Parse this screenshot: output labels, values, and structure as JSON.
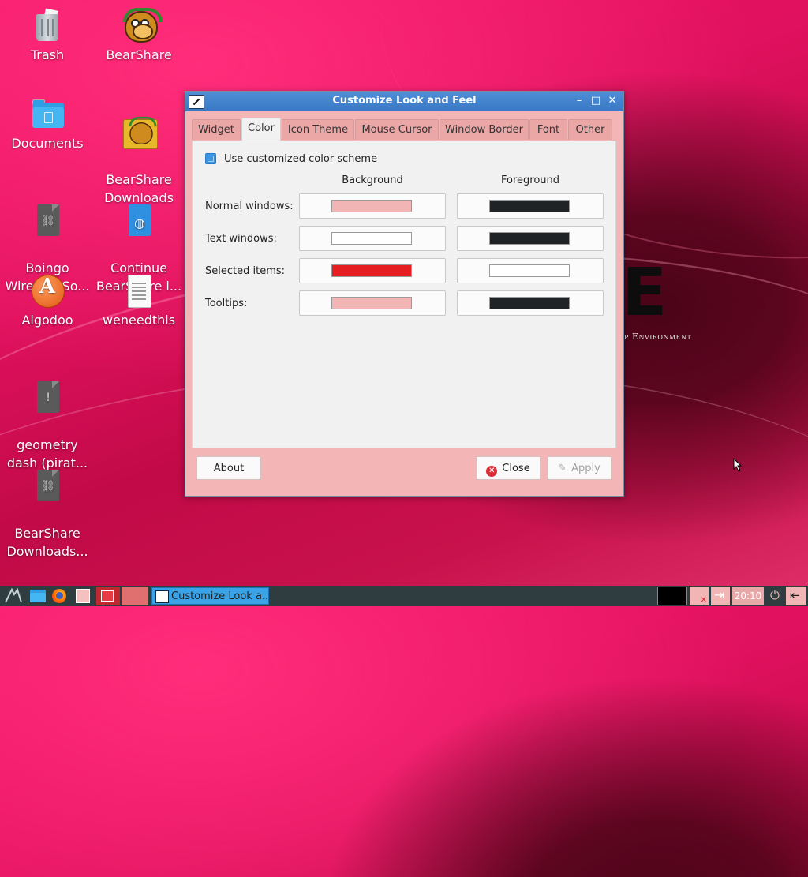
{
  "desktop": {
    "icons": [
      {
        "label": "Trash",
        "icon": "trash-icon"
      },
      {
        "label": "BearShare",
        "icon": "bearshare-icon"
      },
      {
        "label": "Documents",
        "icon": "folder-icon"
      },
      {
        "label": "BearShare\nDownloads",
        "icon": "bearshare-folder-icon"
      },
      {
        "label": "Boingo\nWireless So...",
        "icon": "archive-file-icon"
      },
      {
        "label": "Continue\nBearShare i...",
        "icon": "web-file-icon"
      },
      {
        "label": "Algodoo",
        "icon": "algodoo-icon"
      },
      {
        "label": "weneedthis",
        "icon": "text-file-icon"
      },
      {
        "label": "geometry\ndash (pirat...",
        "icon": "warning-file-icon"
      },
      {
        "label": "BearShare\nDownloads...",
        "icon": "archive-file-icon"
      }
    ],
    "wallpaper_text": {
      "letter": "E",
      "subtitle": "op Environment"
    }
  },
  "dialog": {
    "title": "Customize Look and Feel",
    "tabs": [
      "Widget",
      "Color",
      "Icon Theme",
      "Mouse Cursor",
      "Window Border",
      "Font",
      "Other"
    ],
    "active_tab": "Color",
    "checkbox_label": "Use customized color scheme",
    "columns": {
      "background": "Background",
      "foreground": "Foreground"
    },
    "rows": [
      {
        "label": "Normal windows:",
        "bg": "#f2b5b5",
        "fg": "#1f2326"
      },
      {
        "label": "Text windows:",
        "bg": "#ffffff",
        "fg": "#1f2326"
      },
      {
        "label": "Selected items:",
        "bg": "#e51e22",
        "fg": "#ffffff"
      },
      {
        "label": "Tooltips:",
        "bg": "#f2b5b5",
        "fg": "#1f2326"
      }
    ],
    "buttons": {
      "about": "About",
      "close": "Close",
      "apply": "Apply"
    }
  },
  "taskbar": {
    "task_label": "Customize Look a...",
    "clock": "20:10"
  },
  "colors": {
    "accent": "#3a96e0",
    "dialog_bg": "#f3b5b5",
    "titlebar": "#3978c5"
  }
}
